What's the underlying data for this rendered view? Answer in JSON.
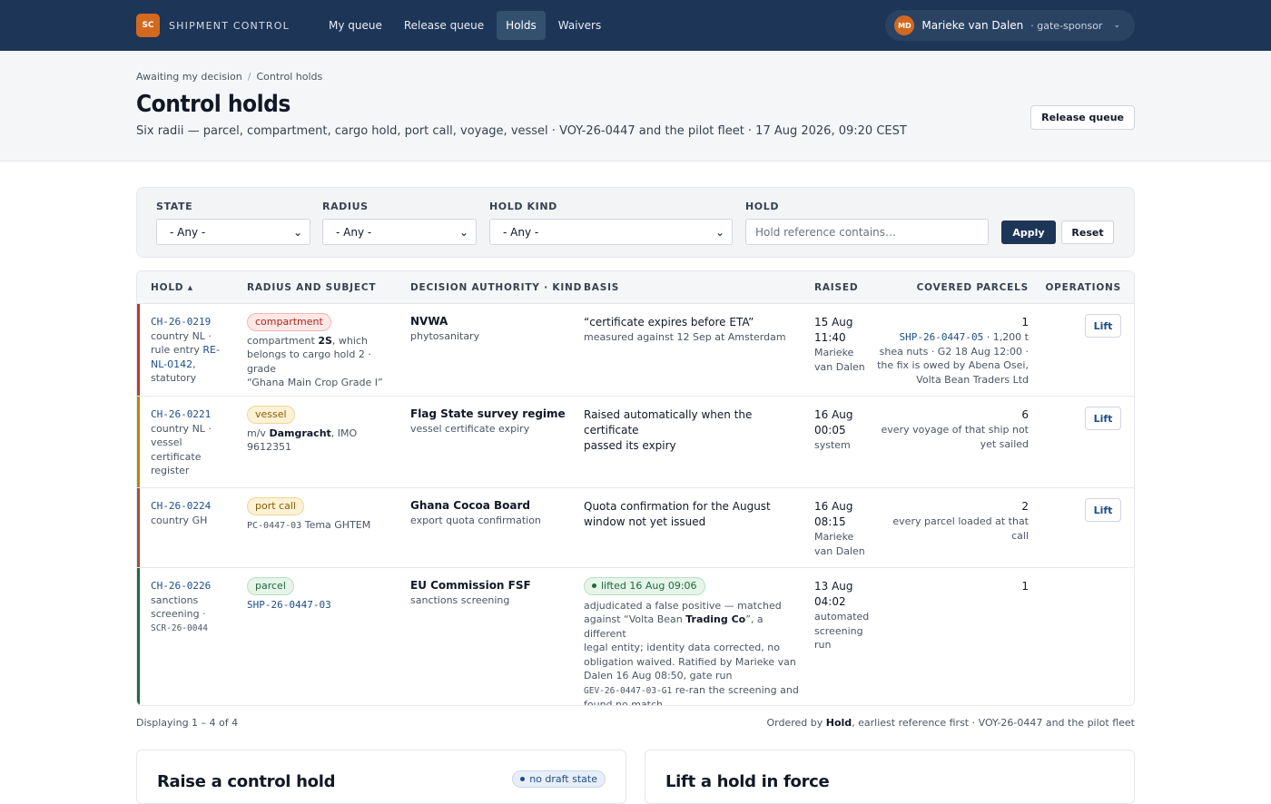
{
  "brand": {
    "logo": "SC",
    "name": "SHIPMENT CONTROL"
  },
  "nav": [
    {
      "label": "My queue"
    },
    {
      "label": "Release queue"
    },
    {
      "label": "Holds"
    },
    {
      "label": "Waivers"
    }
  ],
  "user": {
    "initials": "MD",
    "name": "Marieke van Dalen",
    "role": "· gate-sponsor",
    "chevron": "⌄"
  },
  "breadcrumb": {
    "parent": "Awaiting my decision",
    "sep": "/",
    "current": "Control holds"
  },
  "page": {
    "title": "Control holds",
    "subtitle": "Six radii — parcel, compartment, cargo hold, port call, voyage, vessel · VOY-26-0447 and the pilot fleet · 17 Aug 2026, 09:20 CEST",
    "release_button": "Release queue"
  },
  "filters": {
    "state": {
      "label": "STATE",
      "value": "- Any -"
    },
    "radius": {
      "label": "RADIUS",
      "value": "- Any -"
    },
    "hold_kind": {
      "label": "HOLD KIND",
      "value": "- Any -"
    },
    "hold": {
      "label": "HOLD",
      "placeholder": "Hold reference contains…"
    },
    "apply": "Apply",
    "reset": "Reset",
    "select_arrow": "⌄"
  },
  "table": {
    "headers": {
      "hold": "HOLD ▴",
      "radius": "RADIUS AND SUBJECT",
      "authority": "DECISION AUTHORITY · KIND",
      "basis": "BASIS",
      "raised": "RAISED",
      "covered": "COVERED PARCELS",
      "operations": "OPERATIONS"
    },
    "rows": [
      {
        "ref": "CH-26-0219",
        "hold_l1": "country NL ·",
        "hold_l2a": "rule entry ",
        "hold_l2b": "RE-",
        "hold_l3a": "NL-0142",
        "hold_l3b": ",",
        "hold_l4": "statutory",
        "radius": "compartment",
        "subj_l1a": "compartment ",
        "subj_l1b": "2S",
        "subj_l1c": ", which",
        "subj_l2": "belongs to cargo hold 2 · grade",
        "subj_l3": "“Ghana Main Crop Grade I”",
        "authority": "NVWA",
        "kind": "phytosanitary",
        "basis_l1": "“certificate expires before ETA”",
        "basis_l2": "measured against 12 Sep at Amsterdam",
        "raised_date": "15 Aug",
        "raised_time": "11:40",
        "raised_by_l1": "Marieke",
        "raised_by_l2": "van Dalen",
        "count": "1",
        "cov_l1a": "SHP-26-0447-05",
        "cov_l1b": " · 1,200 t",
        "cov_l2": "shea nuts · G2 18 Aug 12:00 ·",
        "cov_l3": "the fix is owed by Abena Osei,",
        "cov_l4": "Volta Bean Traders Ltd",
        "action": "Lift"
      },
      {
        "ref": "CH-26-0221",
        "hold_l1": "country NL ·",
        "hold_l2": "vessel",
        "hold_l3": "certificate",
        "hold_l4": "register",
        "radius": "vessel",
        "subj_a": "m/v ",
        "subj_b": "Damgracht",
        "subj_c": ", IMO 9612351",
        "authority": "Flag State survey regime",
        "kind": "vessel certificate expiry",
        "basis_l1": "Raised automatically when the certificate",
        "basis_l2": "passed its expiry",
        "raised_date": "16 Aug",
        "raised_time": "00:05",
        "raised_by_l1": "system",
        "count": "6",
        "cov_l1": "every voyage of that ship not",
        "cov_l2": "yet sailed",
        "action": "Lift"
      },
      {
        "ref": "CH-26-0224",
        "hold_l1": "country GH",
        "radius": "port call",
        "subj_a": "PC-0447-03",
        "subj_b": " Tema GHTEM",
        "authority": "Ghana Cocoa Board",
        "kind": "export quota confirmation",
        "basis_l1": "Quota confirmation for the August",
        "basis_l2": "window not yet issued",
        "raised_date": "16 Aug",
        "raised_time": "08:15",
        "raised_by_l1": "Marieke",
        "raised_by_l2": "van Dalen",
        "count": "2",
        "cov_l1": "every parcel loaded at that",
        "cov_l2": "call",
        "action": "Lift"
      },
      {
        "ref": "CH-26-0226",
        "hold_l1": "sanctions",
        "hold_l2": "screening ·",
        "hold_l3": "SCR-26-0044",
        "radius": "parcel",
        "subj": "SHP-26-0447-03",
        "authority": "EU Commission FSF",
        "kind": "sanctions screening",
        "lifted": "lifted 16 Aug 09:06",
        "b1": "adjudicated a false positive — matched",
        "b2a": "against “Volta Bean ",
        "b2b": "Trading Co",
        "b2c": "”, a different",
        "b3": "legal entity; identity data corrected, no",
        "b4": "obligation waived. Ratified by Marieke van",
        "b5": "Dalen 16 Aug 08:50, gate run",
        "b6a": "GEV-26-0447-03-G1",
        "b6b": " re-ran the screening and",
        "b7": "found no match",
        "raised_date": "13 Aug",
        "raised_time": "04:02",
        "raised_by_l1": "automated",
        "raised_by_l2": "screening",
        "raised_by_l3": "run",
        "count": "1"
      }
    ]
  },
  "footer": {
    "displaying": "Displaying 1 – 4 of 4",
    "order_a": "Ordered by ",
    "order_b": "Hold",
    "order_c": ", earliest reference first · VOY-26-0447 and the pilot fleet"
  },
  "cards": {
    "raise_title": "Raise a control hold",
    "draft": "no draft state",
    "lift_title": "Lift a hold in force"
  },
  "colors": {
    "nav_bg": "#1d3557",
    "accent_red": "#c0392b",
    "accent_amber": "#b8860b",
    "accent_brown": "#a0522d",
    "accent_green": "#1e6b3a"
  }
}
